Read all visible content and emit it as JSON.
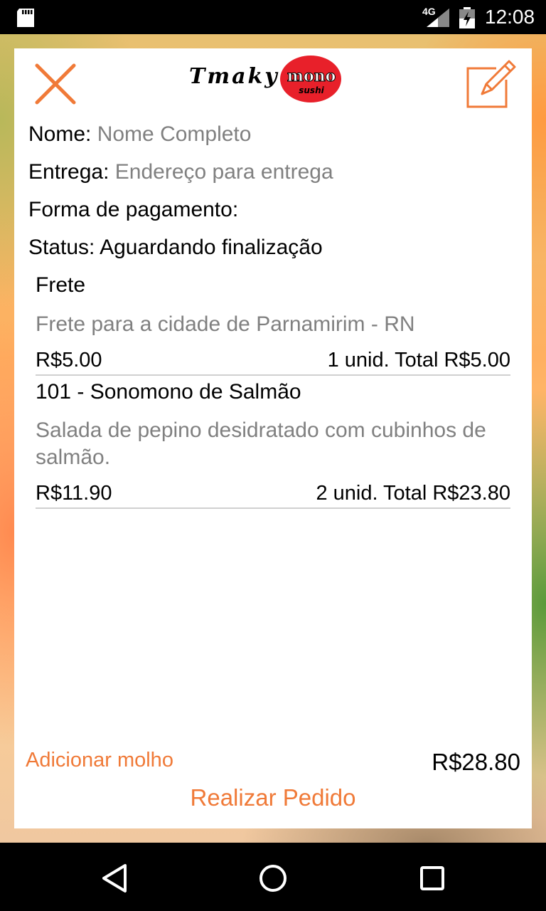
{
  "status_bar": {
    "network": "4G",
    "time": "12:08"
  },
  "header": {
    "logo_text": "Tmaky",
    "logo_mono": "mono",
    "logo_sushi": "sushi",
    "close_icon": "close-icon",
    "edit_icon": "edit-icon"
  },
  "order": {
    "name_label": "Nome:",
    "name_placeholder": "Nome Completo",
    "delivery_label": "Entrega:",
    "delivery_placeholder": "Endereço para entrega",
    "payment_label": "Forma de pagamento:",
    "status_label": "Status:",
    "status_value": "Aguardando finalização"
  },
  "items": [
    {
      "title": "Frete",
      "description": "Frete para a cidade de Parnamirim - RN",
      "price": "R$5.00",
      "total": "1 unid. Total R$5.00"
    },
    {
      "title": "101 - Sonomono de Salmão",
      "description": "Salada de pepino desidratado com cubinhos de salmão.",
      "price": "R$11.90",
      "total": "2 unid. Total R$23.80"
    }
  ],
  "footer": {
    "add_sauce": "Adicionar molho",
    "grand_total": "R$28.80",
    "place_order": "Realizar Pedido"
  },
  "colors": {
    "accent": "#f07a38",
    "placeholder": "#808080",
    "logo_red": "#e8202a"
  },
  "nav_bar": {
    "back_icon": "back-triangle-icon",
    "home_icon": "home-circle-icon",
    "recents_icon": "recents-square-icon"
  }
}
